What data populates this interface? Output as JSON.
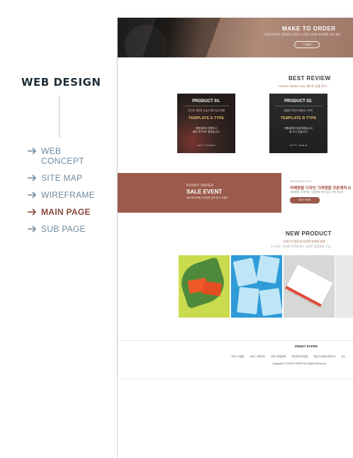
{
  "side": {
    "title": "WEB DESIGN",
    "nav": [
      {
        "label": "WEB CONCEPT",
        "active": false
      },
      {
        "label": "SITE MAP",
        "active": false
      },
      {
        "label": "WIREFRAME",
        "active": false
      },
      {
        "label": "MAIN PAGE",
        "active": true
      },
      {
        "label": "SUB PAGE",
        "active": false
      }
    ]
  },
  "colors": {
    "accent": "#9b5a4c",
    "navText": "#6e8aa0",
    "active": "#8a4a3c",
    "title": "#1f2f3a"
  },
  "mock": {
    "hero": {
      "title": "MAKE TO ORDER",
      "subtitle": "다양한 분야의 명함제작 다음이 고객의 요청에 따라제작 요청 제작",
      "button": "+ 자세히"
    },
    "review": {
      "title": "BEST REVIEW",
      "subtitle": "- PENNY PAPER 2022 베스트 상품 후기 -",
      "cards": [
        {
          "title": "PRODUCT 01.",
          "desc": "친근한 색감과 고급스러운 감성 명함",
          "template": "TEMPLATE A TYPE",
          "review1": "명함퀄리티 아름답고",
          "review2": "빠른 피드백도 좋았습니다.",
          "meta": "kim***** | 22.06.20"
        },
        {
          "title": "PRODUCT 02.",
          "desc": "깔끔한 모던스타일의 스티커",
          "template": "TEMPLATE B TYPE",
          "review1": "명함퀄리티 깔끔하였습니다",
          "review2": "잘 쓰고 있습니다!",
          "meta": "cho***** | 22.06.25"
        }
      ]
    },
    "sale": {
      "eyebrow": "PENNY PAPER",
      "title": "SALE EVENT",
      "desc": "페니페이퍼에서 준비한 금액 감사 이벤트"
    },
    "promo": {
      "eyebrow": "#BUSINESS CARD",
      "title": "카페명함 디자인 가게명함 쿠폰제작 R",
      "desc": "카페명함, 가게명함, 쿠폰명함 등과 같은 사용 가능한",
      "button": "BUY NOW"
    },
    "new": {
      "title": "NEW PRODUCT",
      "subtitle": "디자인 트렌드와 다양한 분야에 맞춰",
      "subtitle2": "추구하는 가치와 목적에 맞는 디자인 명함들을 구성"
    },
    "footer": {
      "brand": "PENNY PAPER",
      "links": [
        "서비스 도움말",
        "서비스 이용약관",
        "서비스 운영정책",
        "개인정보처리방침",
        "책임의 한계와 법적고지",
        "게시"
      ],
      "copyright": "Copyright © PENNY PAPER All Rights Reserved."
    }
  }
}
